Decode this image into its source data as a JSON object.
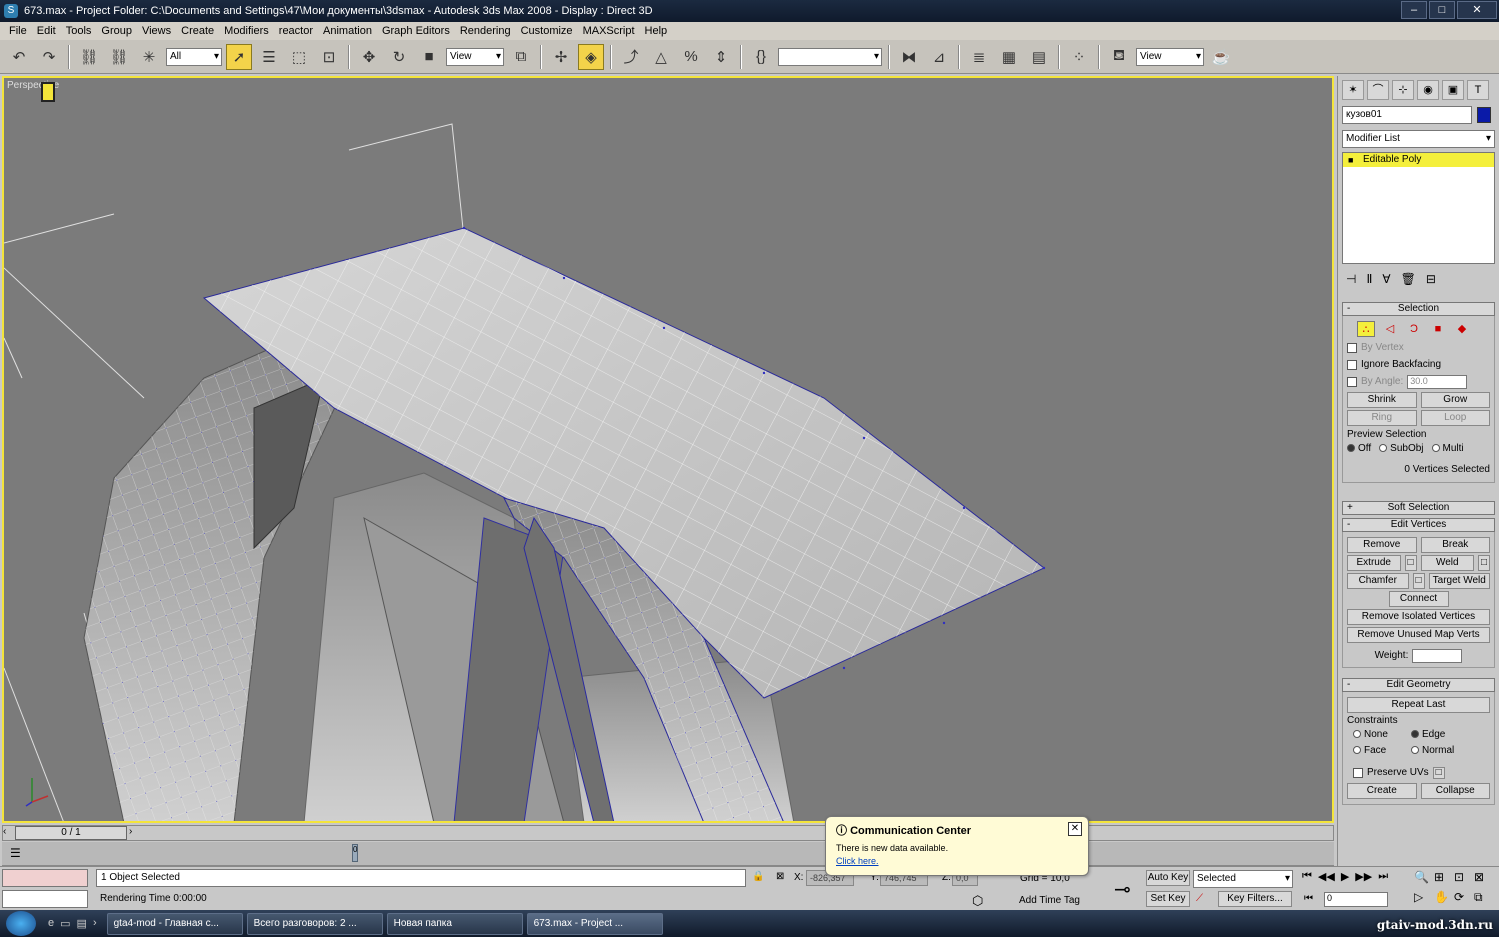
{
  "window": {
    "title": "673.max    - Project Folder: C:\\Documents and Settings\\47\\Мои документы\\3dsmax    - Autodesk 3ds Max 2008    - Display : Direct 3D"
  },
  "menu": [
    "File",
    "Edit",
    "Tools",
    "Group",
    "Views",
    "Create",
    "Modifiers",
    "reactor",
    "Animation",
    "Graph Editors",
    "Rendering",
    "Customize",
    "MAXScript",
    "Help"
  ],
  "toolbar": {
    "filter_value": "All",
    "ref_coord_value": "View",
    "named_sel_value": "",
    "view_value": "View"
  },
  "viewport": {
    "label": "Perspective"
  },
  "command_panel": {
    "object_name": "кузов01",
    "modifier_list": "Modifier List",
    "stack_item": "Editable Poly",
    "selection": {
      "title": "Selection",
      "by_vertex": "By Vertex",
      "ignore_backfacing": "Ignore Backfacing",
      "by_angle": "By Angle:",
      "angle_value": "30.0",
      "shrink": "Shrink",
      "grow": "Grow",
      "ring": "Ring",
      "loop": "Loop",
      "preview_selection": "Preview Selection",
      "off": "Off",
      "subobj": "SubObj",
      "multi": "Multi",
      "status": "0 Vertices Selected"
    },
    "soft_selection": "Soft Selection",
    "edit_vertices": {
      "title": "Edit Vertices",
      "remove": "Remove",
      "break": "Break",
      "extrude": "Extrude",
      "weld": "Weld",
      "chamfer": "Chamfer",
      "target_weld": "Target Weld",
      "connect": "Connect",
      "remove_isolated": "Remove Isolated Vertices",
      "remove_unused": "Remove Unused Map Verts",
      "weight": "Weight:"
    },
    "edit_geometry": {
      "title": "Edit Geometry",
      "repeat_last": "Repeat Last",
      "constraints": "Constraints",
      "none": "None",
      "edge": "Edge",
      "face": "Face",
      "normal": "Normal",
      "preserve_uvs": "Preserve UVs",
      "create": "Create",
      "collapse": "Collapse"
    }
  },
  "timeline": {
    "frame": "0 / 1",
    "track_marker": "0"
  },
  "status": {
    "selected": "1 Object Selected",
    "rendering_time": "Rendering Time  0:00:00",
    "x_value": "-826,357",
    "y_value": "746,745",
    "z_value": "0,0",
    "grid": "Grid = 10,0",
    "add_time_tag": "Add Time Tag",
    "auto_key": "Auto Key",
    "set_key": "Set Key",
    "key_mode_value": "Selected",
    "key_filters": "Key Filters...",
    "current_frame": "0"
  },
  "comm_center": {
    "title": "Communication Center",
    "message": "There is new data available.",
    "link": "Click here."
  },
  "taskbar": {
    "tasks": [
      "gta4-mod - Главная с...",
      "Всего разговоров: 2 ...",
      "Новая папка",
      "673.max    - Project ..."
    ],
    "watermark": "gtaiv-mod.3dn.ru"
  }
}
